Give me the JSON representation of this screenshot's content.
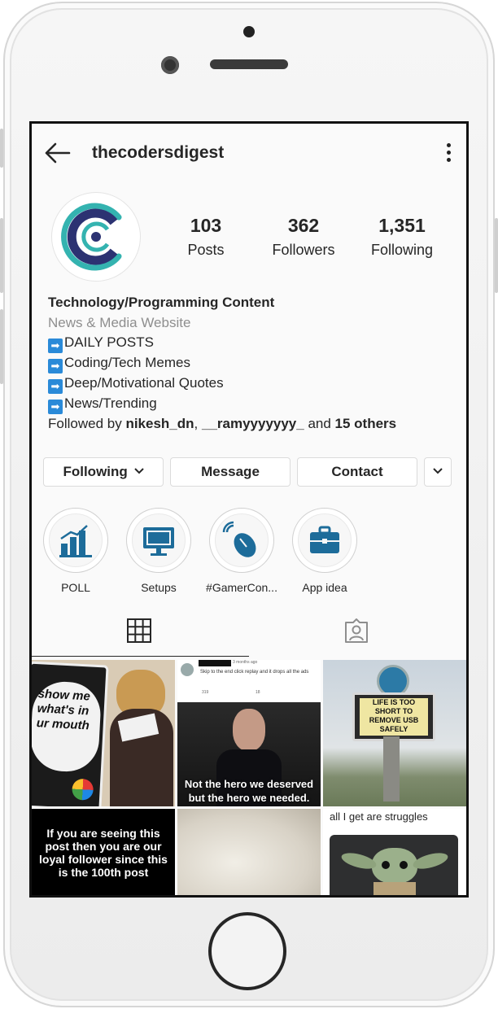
{
  "header": {
    "username": "thecodersdigest"
  },
  "stats": [
    {
      "value": "103",
      "label": "Posts"
    },
    {
      "value": "362",
      "label": "Followers"
    },
    {
      "value": "1,351",
      "label": "Following"
    }
  ],
  "bio": {
    "name": "Technology/Programming Content",
    "category": "News & Media Website",
    "lines": [
      "DAILY POSTS",
      "Coding/Tech Memes",
      "Deep/Motivational Quotes",
      "News/Trending"
    ],
    "arrow_glyph": "➡",
    "followed_by_prefix": "Followed by ",
    "followed_by_user1": "nikesh_dn",
    "followed_by_sep": ", ",
    "followed_by_user2": "__ramyyyyyyy_",
    "followed_by_and": " and ",
    "followed_by_others": "15 others"
  },
  "actions": {
    "following": "Following",
    "message": "Message",
    "contact": "Contact"
  },
  "highlights": [
    {
      "label": "POLL",
      "icon": "bar-chart-icon"
    },
    {
      "label": "Setups",
      "icon": "monitor-icon"
    },
    {
      "label": "#GamerCon...",
      "icon": "mouse-icon"
    },
    {
      "label": "App idea",
      "icon": "briefcase-icon"
    }
  ],
  "tabs": [
    {
      "icon": "grid-icon",
      "active": true
    },
    {
      "icon": "tagged-icon",
      "active": false
    }
  ],
  "posts": {
    "p1_text": "show me what's in ur mouth",
    "p2_header": "3 months ago",
    "p2_comment": "Skip to the end click replay and it drops all the ads",
    "p2_likes": "319",
    "p2_replies": "18",
    "p2_caption1": "Not the hero we deserved",
    "p2_caption2": "but the hero we needed.",
    "p3_sign": "LIFE IS TOO SHORT TO REMOVE USB SAFELY",
    "p4_text": "If you are seeing this post then you are our loyal follower since this is the 100th post",
    "p6_text": "all I get are struggles"
  },
  "colors": {
    "text": "#262626",
    "muted": "#8e8e8e",
    "brand_teal": "#34b3b0",
    "brand_navy": "#2c3272",
    "arrow_blue": "#2a8ad8",
    "hl_icon": "#1d6c9a"
  }
}
